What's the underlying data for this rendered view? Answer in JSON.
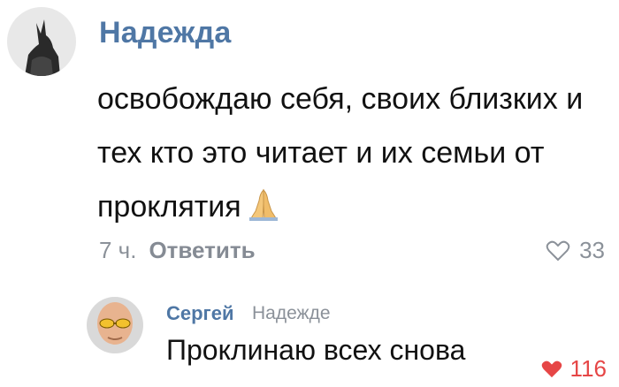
{
  "comment": {
    "author": "Надежда",
    "text": "освобождаю себя, своих близких и тех кто это читает и их семьи от проклятия",
    "emoji": "folded-hands-icon",
    "time": "7 ч.",
    "reply_label": "Ответить",
    "likes": "33",
    "like_color": "#8b9199"
  },
  "reply": {
    "author": "Сергей",
    "reply_to": "Надежде",
    "text": "Проклинаю всех снова",
    "likes": "116",
    "like_color": "#e64646"
  },
  "colors": {
    "author_link": "#4f77a5",
    "text": "#111111",
    "meta": "#8b9199"
  }
}
